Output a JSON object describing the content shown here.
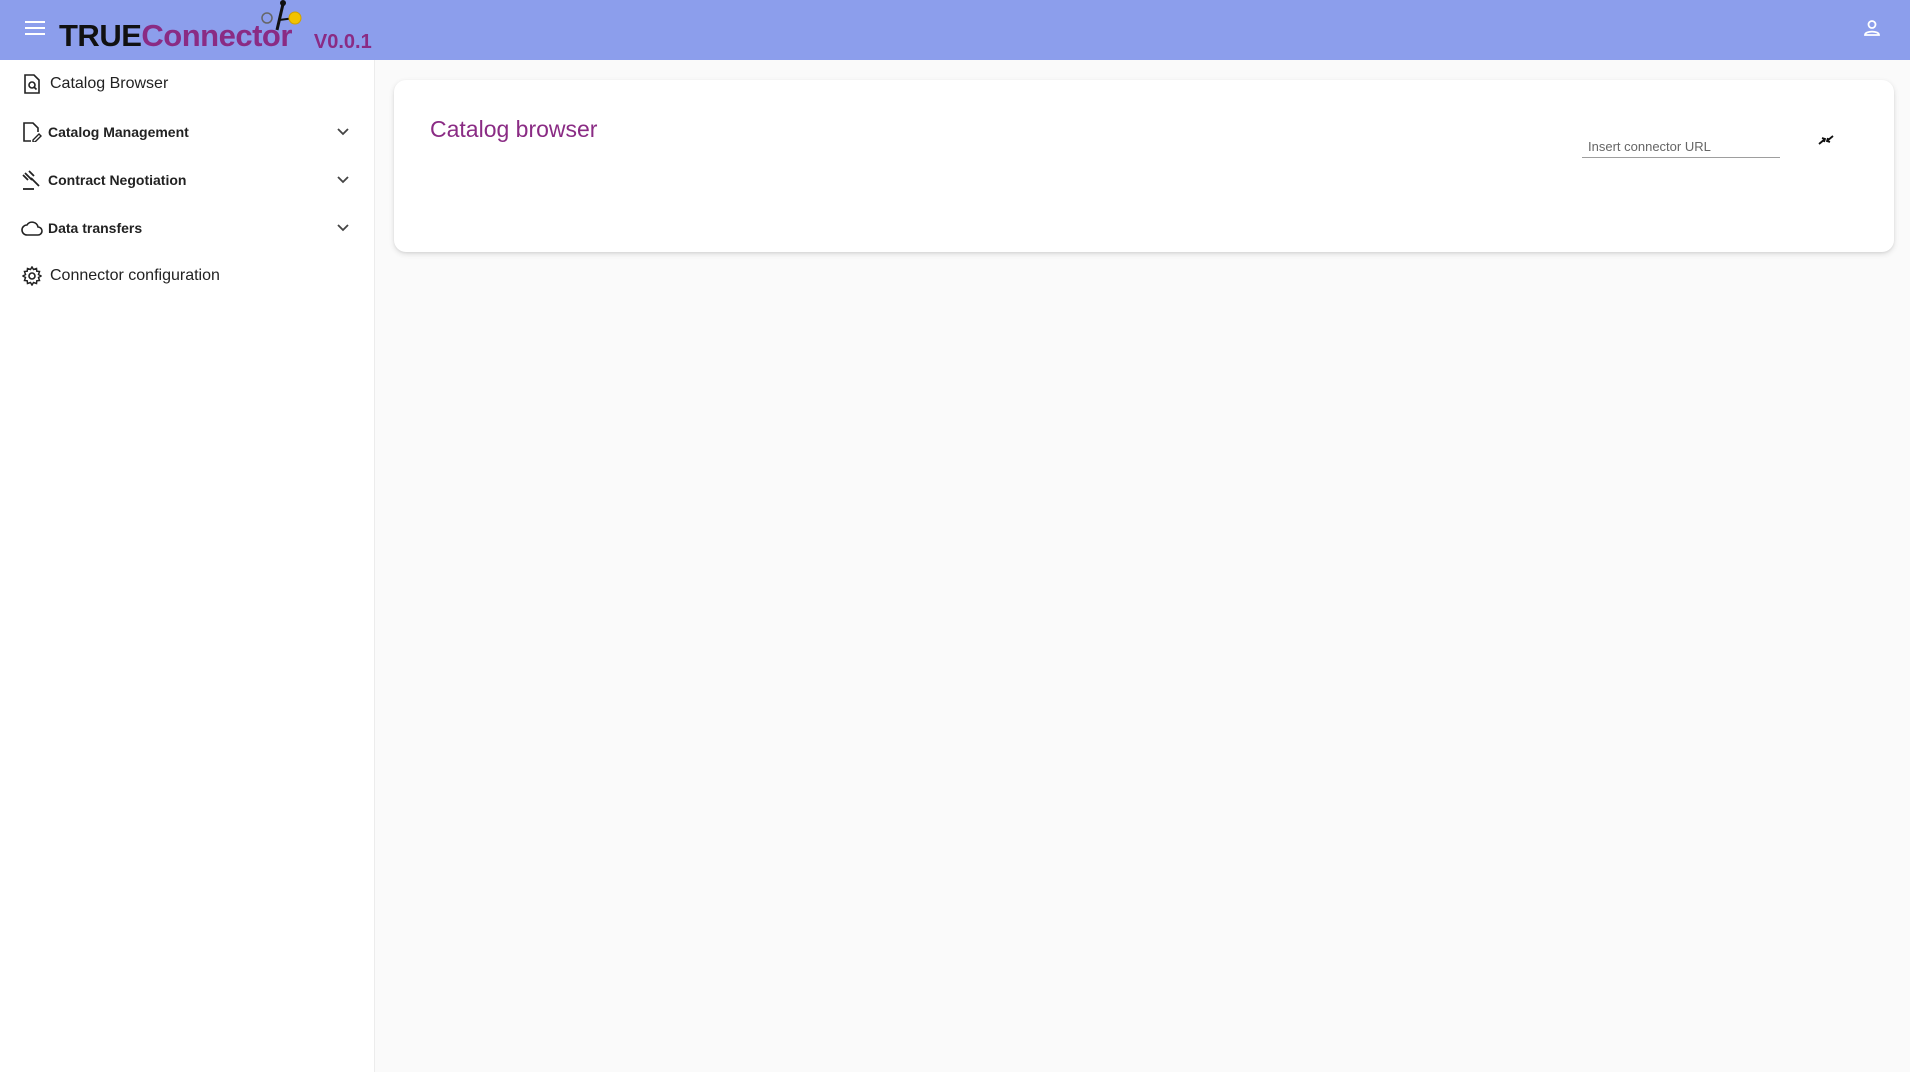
{
  "header": {
    "logo_part1": "TRUE",
    "logo_part2": "Connector",
    "version": "V0.0.1",
    "background_color": "#8c9eec",
    "brand_color": "#8a2b84",
    "menu_icon": "hamburger-menu-icon",
    "user_icon": "person-icon"
  },
  "sidebar": {
    "items": [
      {
        "label": "Catalog Browser",
        "icon": "document-search-icon",
        "expandable": false
      },
      {
        "label": "Catalog Management",
        "icon": "document-edit-icon",
        "expandable": true
      },
      {
        "label": "Contract Negotiation",
        "icon": "gavel-icon",
        "expandable": true
      },
      {
        "label": "Data transfers",
        "icon": "cloud-icon",
        "expandable": true
      },
      {
        "label": "Connector configuration",
        "icon": "gear-icon",
        "expandable": false
      }
    ]
  },
  "main": {
    "card_title": "Catalog browser",
    "url_input": {
      "placeholder": "Insert connector URL",
      "value": ""
    },
    "connect_icon": "connect-plug-icon"
  }
}
